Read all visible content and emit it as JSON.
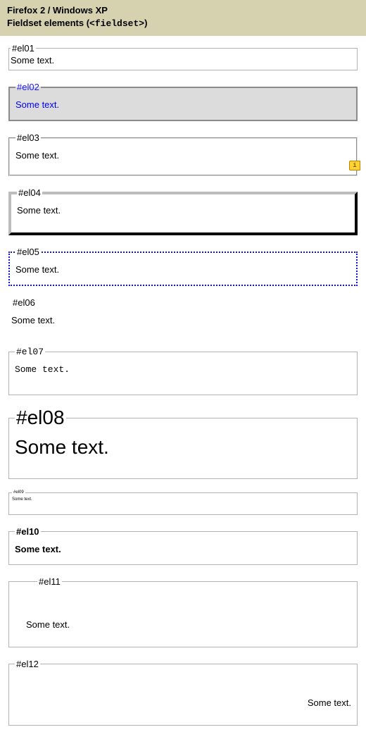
{
  "header": {
    "title_line1": "Firefox 2 / Windows XP",
    "title_line2_prefix": "Fieldset elements (",
    "title_line2_code": "<fieldset>",
    "title_line2_suffix": ")"
  },
  "info_badge": "i",
  "fieldsets": {
    "el01": {
      "legend": "#el01",
      "text": "Some text."
    },
    "el02": {
      "legend": "#el02",
      "text": "Some text."
    },
    "el03": {
      "legend": "#el03",
      "text": "Some text."
    },
    "el04": {
      "legend": "#el04",
      "text": "Some text."
    },
    "el05": {
      "legend": "#el05",
      "text": "Some text."
    },
    "el06": {
      "legend": "#el06",
      "text": "Some text."
    },
    "el07": {
      "legend": "#el07",
      "text": "Some text."
    },
    "el08": {
      "legend": "#el08",
      "text": "Some text."
    },
    "el09": {
      "legend": "#el09",
      "text": "Some text."
    },
    "el10": {
      "legend": "#el10",
      "text": "Some text."
    },
    "el11": {
      "legend": "#el11",
      "text": "Some text."
    },
    "el12": {
      "legend": "#el12",
      "text": "Some text."
    }
  }
}
